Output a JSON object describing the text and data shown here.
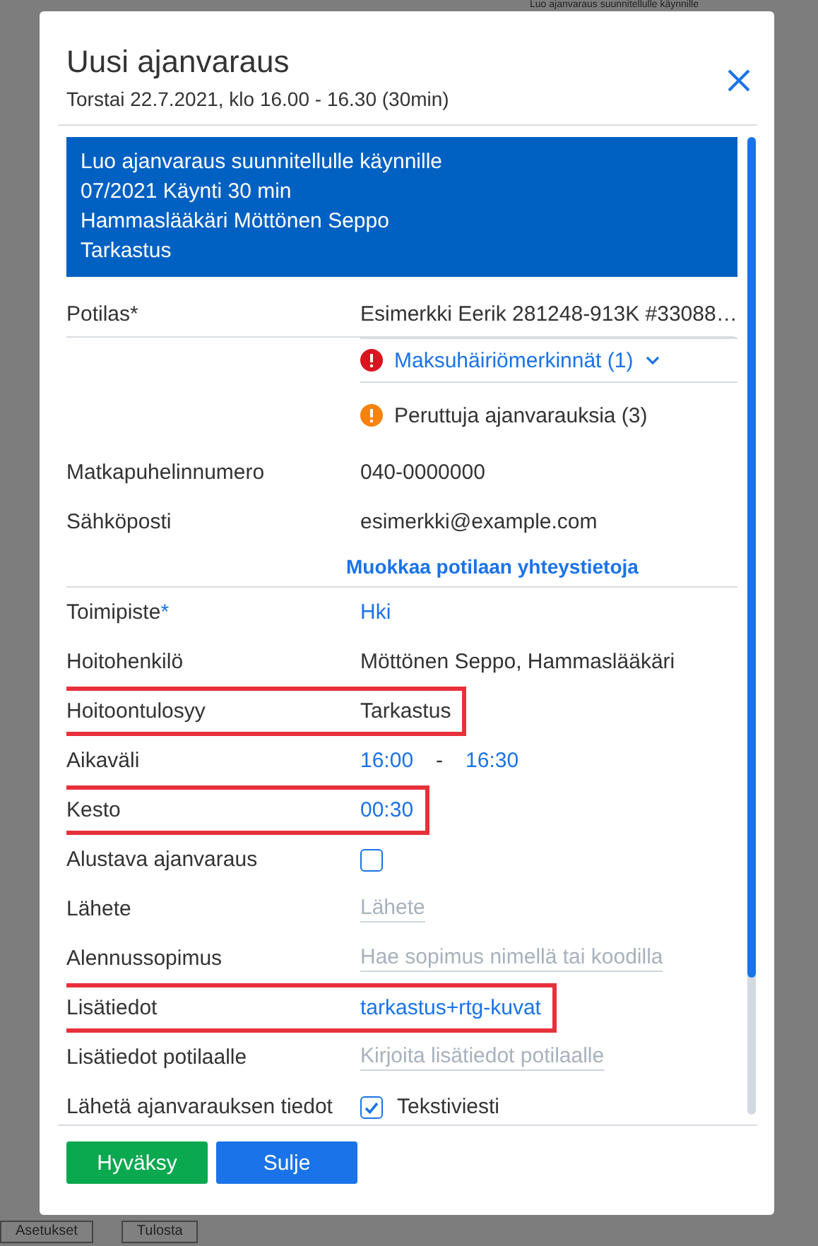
{
  "background": {
    "top_text": "Luo ajanvaraus suunnitellulle käynnille",
    "bottom_buttons": [
      "Asetukset",
      "Tulosta"
    ]
  },
  "dialog": {
    "title": "Uusi ajanvaraus",
    "subtitle": "Torstai 22.7.2021, klo 16.00 - 16.30 (30min)",
    "banner": [
      "Luo ajanvaraus suunnitellulle käynnille",
      "07/2021 Käynti 30 min",
      "Hammaslääkäri Möttönen Seppo",
      "Tarkastus"
    ],
    "rows": [
      {
        "kind": "text",
        "label": "Potilas*",
        "value": "Esimerkki Eerik 281248-913K #33088…",
        "highlighted": false
      },
      {
        "kind": "alert",
        "value": "Maksuhäiriömerkinnät (1)",
        "expanded": false
      },
      {
        "kind": "warning",
        "value": "Peruttuja ajanvarauksia (3)"
      },
      {
        "kind": "text",
        "label": "Matkapuhelinnumero",
        "value": "040-0000000",
        "highlighted": false
      },
      {
        "kind": "text",
        "label": "Sähköposti",
        "value": "esimerkki@example.com",
        "highlighted": false
      },
      {
        "kind": "action",
        "value": "Muokkaa potilaan yhteystietoja"
      },
      {
        "kind": "link",
        "label": "Toimipiste",
        "required_mark": "*",
        "value": "Hki",
        "highlighted": false
      },
      {
        "kind": "text",
        "label": "Hoitohenkilö",
        "value": "Möttönen Seppo, Hammaslääkäri",
        "highlighted": false
      },
      {
        "kind": "text",
        "label": "Hoitoontulosyy",
        "value": "Tarkastus",
        "highlighted": true
      },
      {
        "kind": "range",
        "label": "Aikaväli",
        "from": "16:00",
        "separator": "-",
        "to": "16:30",
        "highlighted": false
      },
      {
        "kind": "link",
        "label": "Kesto",
        "value": "00:30",
        "highlighted": true
      },
      {
        "kind": "checkbox",
        "label": "Alustava ajanvaraus",
        "checked": false,
        "highlighted": false
      },
      {
        "kind": "input",
        "label": "Lähete",
        "placeholder": "Lähete",
        "highlighted": false
      },
      {
        "kind": "input",
        "label": "Alennussopimus",
        "placeholder": "Hae sopimus nimellä tai koodilla",
        "highlighted": false
      },
      {
        "kind": "link",
        "label": "Lisätiedot",
        "value": "tarkastus+rtg-kuvat",
        "highlighted": true
      },
      {
        "kind": "input",
        "label": "Lisätiedot potilaalle",
        "placeholder": "Kirjoita lisätiedot potilaalle",
        "highlighted": false
      },
      {
        "kind": "checkbox",
        "label": "Lähetä ajanvarauksen tiedot",
        "checked": true,
        "option": "Tekstiviesti",
        "highlighted": false
      }
    ],
    "buttons": [
      {
        "label": "Hyväksy",
        "kind": "primary"
      },
      {
        "label": "Sulje",
        "kind": "secondary"
      }
    ]
  }
}
